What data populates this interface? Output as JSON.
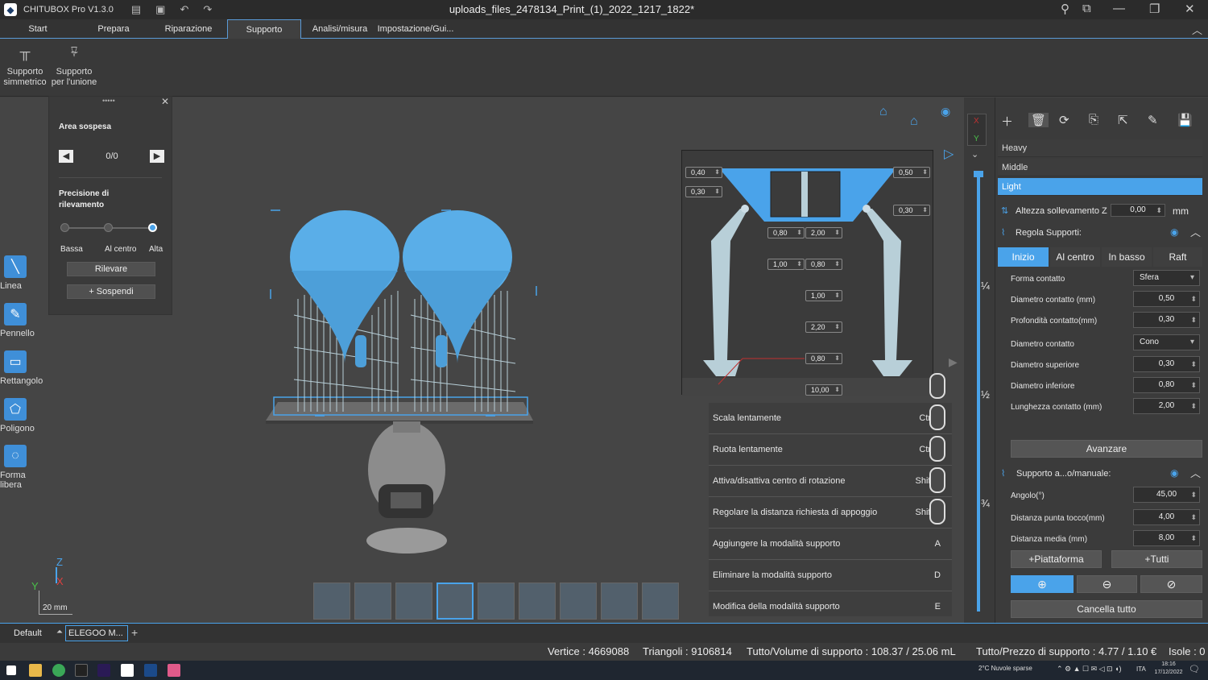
{
  "window": {
    "app_name": "CHITUBOX Pro V1.3.0",
    "document_title": "uploads_files_2478134_Print_(1)_2022_1217_1822*"
  },
  "menu": {
    "tabs": [
      "Start",
      "Prepara",
      "Riparazione",
      "Supporto",
      "Analisi/misura",
      "Impostazione/Gui..."
    ],
    "active_tab": "Supporto"
  },
  "ribbon": {
    "buttons": [
      {
        "label_line1": "Supporto",
        "label_line2": "simmetrico"
      },
      {
        "label_line1": "Supporto",
        "label_line2": "per l'unione"
      }
    ]
  },
  "hang_panel": {
    "handle": "•••••",
    "title": "Area sospesa",
    "counter": "0/0",
    "precision_title_1": "Precisione di",
    "precision_title_2": "rilevamento",
    "levels": [
      "Bassa",
      "Al centro",
      "Alta"
    ],
    "selected_level": "Alta",
    "detect_button": "Rilevare",
    "suspend_button": "+ Sospendi"
  },
  "left_tools": [
    "Linea",
    "Pennello",
    "Rettangolo",
    "Poligono",
    "Forma libera"
  ],
  "axes": {
    "x": "X",
    "y": "Y",
    "z": "Z",
    "scale": "20 mm"
  },
  "diagram_values": {
    "top_left_1": "0,40",
    "top_left_2": "0,30",
    "top_right_1": "0,50",
    "top_right_2": "0,30",
    "mid_a1": "0,80",
    "mid_a2": "2,00",
    "mid_b1": "1,00",
    "mid_b2": "0,80",
    "right_1": "1,00",
    "right_2": "2,20",
    "right_3": "0,80",
    "bottom": "10,00"
  },
  "shortcuts": [
    {
      "label": "Scala lentamente",
      "key": "Ctrl +"
    },
    {
      "label": "Ruota lentamente",
      "key": "Ctrl +"
    },
    {
      "label": "Attiva/disattiva centro di rotazione",
      "key": "Shift +"
    },
    {
      "label": "Regolare la distanza richiesta di appoggio",
      "key": "Shift +"
    },
    {
      "label": "Aggiungere la modalità supporto",
      "key": "A"
    },
    {
      "label": "Eliminare la modalità supporto",
      "key": "D"
    },
    {
      "label": "Modifica della modalità supporto",
      "key": "E"
    }
  ],
  "slider": {
    "axis_x": "X",
    "axis_y": "Y",
    "quarter": "¼",
    "half": "½",
    "three_quarter": "¾"
  },
  "right_panel": {
    "presets": [
      "Heavy",
      "Middle",
      "Light"
    ],
    "selected_preset": "Light",
    "lift_label": "Altezza sollevamento Z",
    "lift_value": "0,00",
    "lift_unit": "mm",
    "support_settings_title": "Regola Supporti:",
    "segment_tabs": [
      "Inizio",
      "Al centro",
      "In basso",
      "Raft"
    ],
    "selected_segment": "Inizio",
    "fields": [
      {
        "label": "Forma contatto",
        "value": "Sfera",
        "kind": "select"
      },
      {
        "label": "Diametro contatto (mm)",
        "value": "0,50",
        "kind": "number"
      },
      {
        "label": "Profondità contatto(mm)",
        "value": "0,30",
        "kind": "number"
      },
      {
        "label": "Diametro contatto",
        "value": "Cono",
        "kind": "select"
      },
      {
        "label": "Diametro superiore",
        "value": "0,30",
        "kind": "number"
      },
      {
        "label": "Diametro inferiore",
        "value": "0,80",
        "kind": "number"
      },
      {
        "label": "Lunghezza contatto (mm)",
        "value": "2,00",
        "kind": "number"
      }
    ],
    "advance_button": "Avanzare",
    "auto_title": "Supporto a...o/manuale:",
    "auto_fields": [
      {
        "label": "Angolo(°)",
        "value": "45,00"
      },
      {
        "label": "Distanza punta tocco(mm)",
        "value": "4,00"
      },
      {
        "label": "Distanza media (mm)",
        "value": "8,00"
      }
    ],
    "platform_button": "+Piattaforma",
    "all_button": "+Tutti",
    "clear_button": "Cancella tutto"
  },
  "profile_bar": {
    "profile": "Default",
    "printer": "ELEGOO M...",
    "add": "+"
  },
  "status": {
    "vertices": "Vertice : 4669088",
    "triangles": "Triangoli : 9106814",
    "volume": "Tutto/Volume di supporto : 108.37 / 25.06 mL",
    "price": "Tutto/Prezzo di supporto : 4.77 / 1.10 €",
    "islands": "Isole : 0"
  },
  "taskbar": {
    "weather": "2°C  Nuvole sparse",
    "lang": "ITA",
    "time": "18:16",
    "date": "17/12/2022"
  },
  "colors": {
    "accent": "#4aa3ea",
    "model": "#5aaee8",
    "support": "#b8cfd8"
  }
}
